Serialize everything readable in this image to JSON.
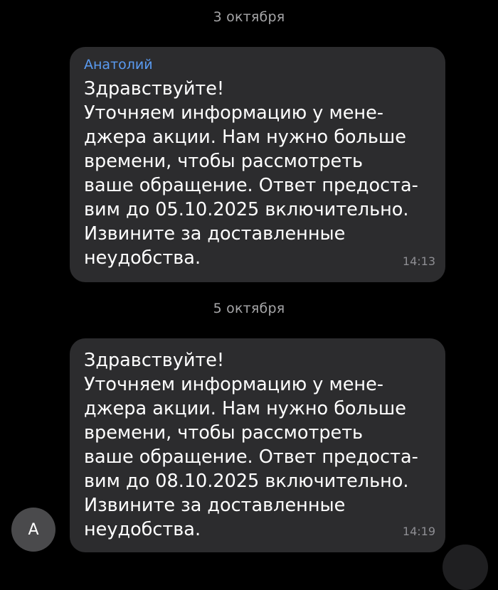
{
  "dates": {
    "first": "3 октября",
    "second": "5 октября"
  },
  "messages": [
    {
      "sender": "Анатолий",
      "text": "Здравствуйте!\nУточняем информацию у мене-\nджера акции. Нам нужно больше\nвремени, чтобы рассмотреть\nваше обращение. Ответ предоста-\nвим до 05.10.2025 включительно.\nИзвините за доставленные\nнеудобства.",
      "time": "14:13"
    },
    {
      "text": "Здравствуйте!\nУточняем информацию у мене-\nджера акции. Нам нужно больше\nвремени, чтобы рассмотреть\nваше обращение. Ответ предоста-\nвим до 08.10.2025 включительно.\nИзвините за доставленные\nнеудобства.",
      "time": "14:19"
    }
  ],
  "avatar": {
    "initial": "А"
  },
  "colors": {
    "background": "#000000",
    "bubble": "#2c2c2e",
    "sender_name": "#5a9bf2",
    "date_text": "#a6a6a8",
    "time_text": "#8e8e93",
    "avatar": "#4a4a4c"
  }
}
